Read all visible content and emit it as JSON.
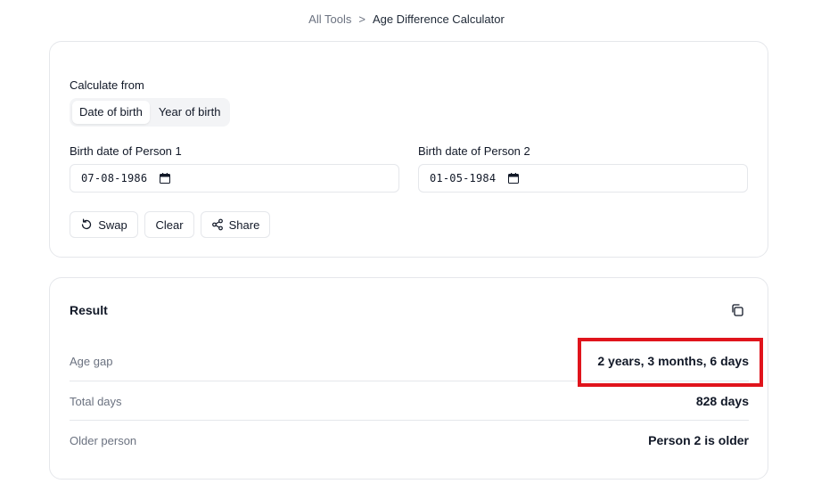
{
  "breadcrumb": {
    "parent": "All Tools",
    "separator": ">",
    "current": "Age Difference Calculator"
  },
  "calculator": {
    "mode_label": "Calculate from",
    "modes": [
      {
        "label": "Date of birth",
        "active": true
      },
      {
        "label": "Year of birth",
        "active": false
      }
    ],
    "person1": {
      "label": "Birth date of Person 1",
      "value": "07-08-1986"
    },
    "person2": {
      "label": "Birth date of Person 2",
      "value": "01-05-1984"
    },
    "actions": {
      "swap": "Swap",
      "clear": "Clear",
      "share": "Share"
    }
  },
  "result": {
    "title": "Result",
    "rows": [
      {
        "key": "Age gap",
        "value": "2 years, 3 months, 6 days"
      },
      {
        "key": "Total days",
        "value": "828 days"
      },
      {
        "key": "Older person",
        "value": "Person 2 is older"
      }
    ]
  },
  "colors": {
    "highlight": "#e0141c",
    "border": "#e5e7eb",
    "muted": "#6b7280"
  }
}
